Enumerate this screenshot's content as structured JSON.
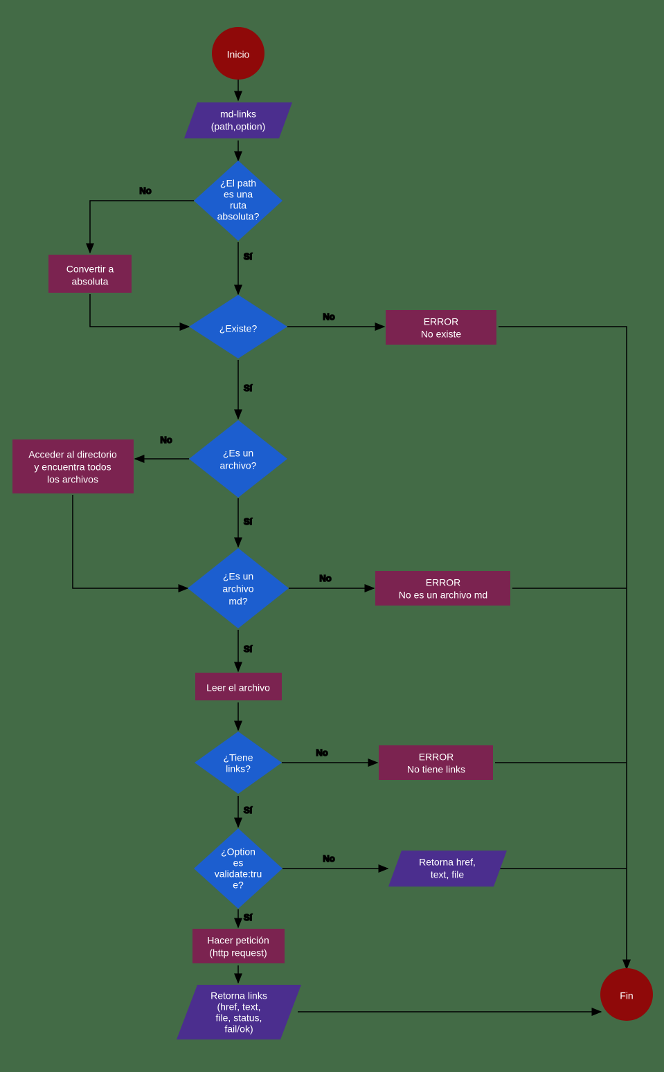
{
  "nodes": {
    "start": {
      "label": "Inicio"
    },
    "mdlinks": {
      "line1": "md-links",
      "line2": "(path,option)"
    },
    "absolute": {
      "line1": "¿El path",
      "line2": "es una",
      "line3": "ruta",
      "line4": "absoluta?"
    },
    "convert": {
      "line1": "Convertir a",
      "line2": "absoluta"
    },
    "exists": {
      "line1": "¿Existe?"
    },
    "err_noexist": {
      "line1": "ERROR",
      "line2": "No existe"
    },
    "isfile": {
      "line1": "¿Es un",
      "line2": "archivo?"
    },
    "accessdir": {
      "line1": "Acceder al directorio",
      "line2": "y encuentra todos",
      "line3": "los archivos"
    },
    "ismd": {
      "line1": "¿Es un",
      "line2": "archivo",
      "line3": "md?"
    },
    "err_notmd": {
      "line1": "ERROR",
      "line2": "No es un archivo md"
    },
    "readfile": {
      "line1": "Leer el archivo"
    },
    "haslinks": {
      "line1": "¿Tiene",
      "line2": "links?"
    },
    "err_nolinks": {
      "line1": "ERROR",
      "line2": "No tiene links"
    },
    "validate": {
      "line1": "¿Option",
      "line2": "es",
      "line3": "validate:tru",
      "line4": "e?"
    },
    "return_basic": {
      "line1": "Retorna href,",
      "line2": "text, file"
    },
    "httprequest": {
      "line1": "Hacer petición",
      "line2": "(http request)"
    },
    "return_full": {
      "line1": "Retorna links",
      "line2": "(href, text,",
      "line3": "file, status,",
      "line4": "fail/ok)"
    },
    "end": {
      "label": "Fin"
    }
  },
  "edges": {
    "yes": "Sí",
    "no": "No"
  },
  "colors": {
    "terminator": "#8F0909",
    "io": "#4B2E8E",
    "decision": "#1C5ECF",
    "process": "#7B2350",
    "arrow": "#000000"
  }
}
